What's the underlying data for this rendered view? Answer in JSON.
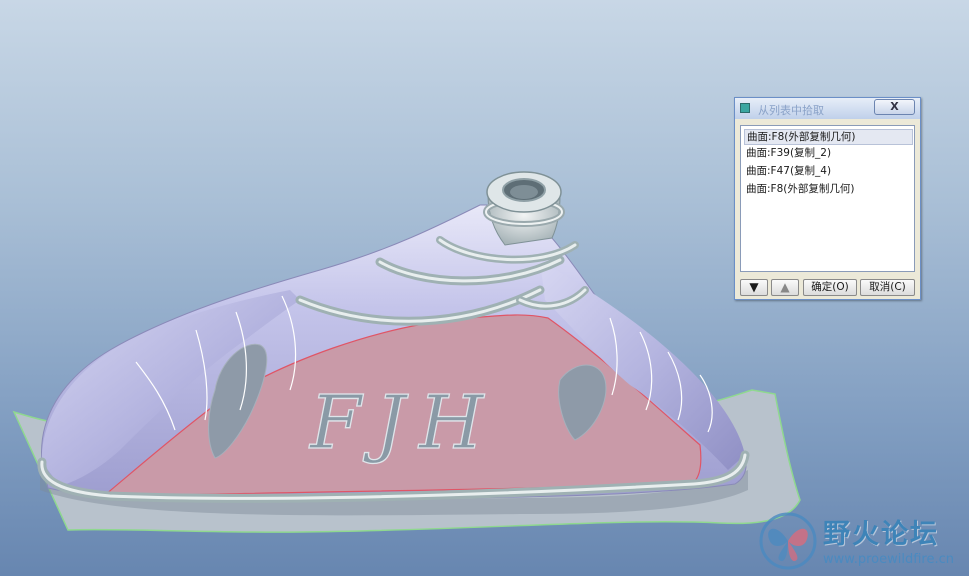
{
  "viewport": {
    "model_text": "FJH",
    "colors": {
      "background_top": "#c8d7e6",
      "background_bottom": "#6786b0",
      "body": "#b9b9e3",
      "body_highlight": "#e3e3f7",
      "selected_surface": "#c99aa8",
      "selected_edge": "#e05566",
      "base_surface": "#b8c2cc",
      "base_edge": "#8fd88f",
      "lettering": "#8a9aa6"
    }
  },
  "dialog": {
    "title": "从列表中拾取",
    "close_label": "X",
    "items": [
      {
        "label": "曲面:F8(外部复制几何)",
        "selected": true
      },
      {
        "label": "曲面:F39(复制_2)",
        "selected": false
      },
      {
        "label": "曲面:F47(复制_4)",
        "selected": false
      },
      {
        "label": "曲面:F8(外部复制几何)",
        "selected": false
      }
    ],
    "down_icon": "arrow-down-icon",
    "up_icon": "arrow-up-icon",
    "ok_label": "确定(O)",
    "cancel_label": "取消(C)"
  },
  "watermark": {
    "title": "野火论坛",
    "url": "www.proewildfire.cn"
  }
}
